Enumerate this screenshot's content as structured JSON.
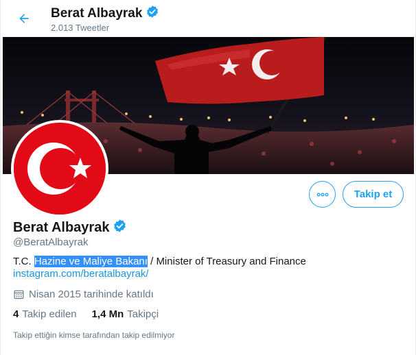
{
  "header": {
    "title": "Berat Albayrak",
    "tweet_count": "2.013 Tweetler"
  },
  "profile": {
    "name": "Berat Albayrak",
    "handle": "@BeratAlbayrak",
    "bio_prefix": "T.C. ",
    "bio_highlight": "Hazine ve Maliye Bakanı",
    "bio_suffix": " / Minister of Treasury and Finance",
    "link": "instagram.com/beratalbayrak/",
    "joined": "Nisan 2015 tarihinde katıldı"
  },
  "stats": {
    "following_count": "4",
    "following_label": "Takip edilen",
    "followers_count": "1,4 Mn",
    "followers_label": "Takipçi"
  },
  "actions": {
    "follow_label": "Takip et",
    "more_icon": "more-icon"
  },
  "note": "Takip ettiğin kimse tarafından takip edilmiyor",
  "colors": {
    "accent": "#1da1f2",
    "link": "#1b95e0",
    "secondary_text": "#657786",
    "flag_red": "#e30a17",
    "selection": "#3390ff"
  }
}
